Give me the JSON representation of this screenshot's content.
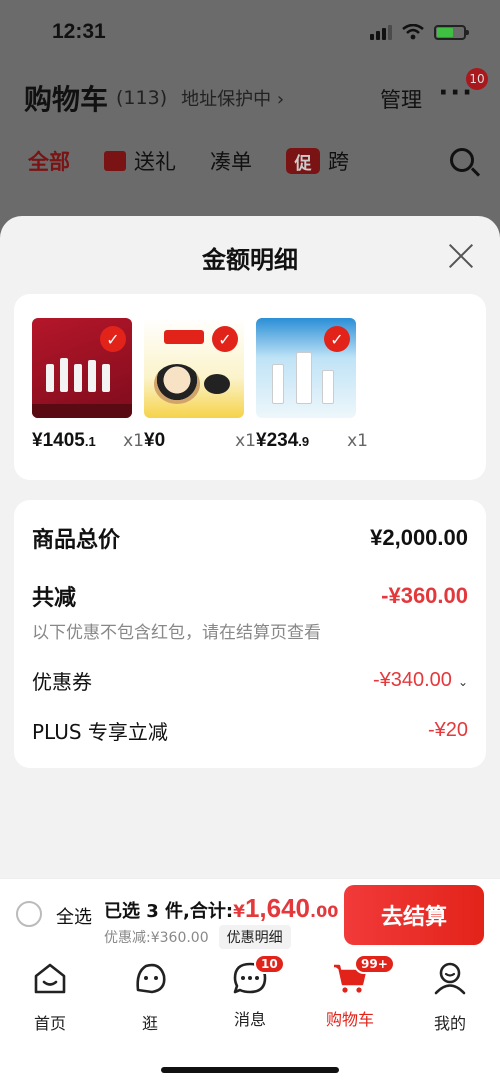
{
  "status_bar": {
    "time": "12:31"
  },
  "cart_header": {
    "title": "购物车",
    "count": "(113)",
    "address": "地址保护中 ›",
    "manage": "管理",
    "more": "···",
    "more_badge": "10"
  },
  "tabs": [
    {
      "label": "全部"
    },
    {
      "label": "送礼"
    },
    {
      "label": "凑单"
    },
    {
      "label": "跨",
      "promo_icon": "促"
    }
  ],
  "sheet": {
    "title": "金额明细",
    "products": [
      {
        "price_main": "¥1405",
        "price_dec": ".1",
        "qty": "x1"
      },
      {
        "price_main": "¥0",
        "price_dec": "",
        "qty": "x1"
      },
      {
        "price_main": "¥234",
        "price_dec": ".9",
        "qty": "x1"
      }
    ],
    "summary": {
      "total_label": "商品总价",
      "total_value": "¥2,000.00",
      "reduce_label": "共减",
      "reduce_value": "-¥360.00",
      "note": "以下优惠不包含红包，请在结算页查看",
      "coupon_label": "优惠券",
      "coupon_value": "-¥340.00",
      "plus_label": "PLUS 专享立减",
      "plus_value": "-¥20"
    }
  },
  "checkout": {
    "select_all": "全选",
    "selected_text": "已选 3 件,合计:",
    "currency": "¥",
    "total_int": "1,640",
    "total_dec": ".00",
    "discount_text": "优惠减:¥360.00",
    "detail_chip": "优惠明细",
    "pay_button": "去结算"
  },
  "tabbar": [
    {
      "label": "首页",
      "icon": "home-icon"
    },
    {
      "label": "逛",
      "icon": "stroll-icon"
    },
    {
      "label": "消息",
      "icon": "message-icon",
      "badge": "10"
    },
    {
      "label": "购物车",
      "icon": "cart-icon",
      "badge": "99+",
      "active": true
    },
    {
      "label": "我的",
      "icon": "profile-icon"
    }
  ],
  "colors": {
    "accent": "#e2231a",
    "price_red": "#e4393c"
  }
}
